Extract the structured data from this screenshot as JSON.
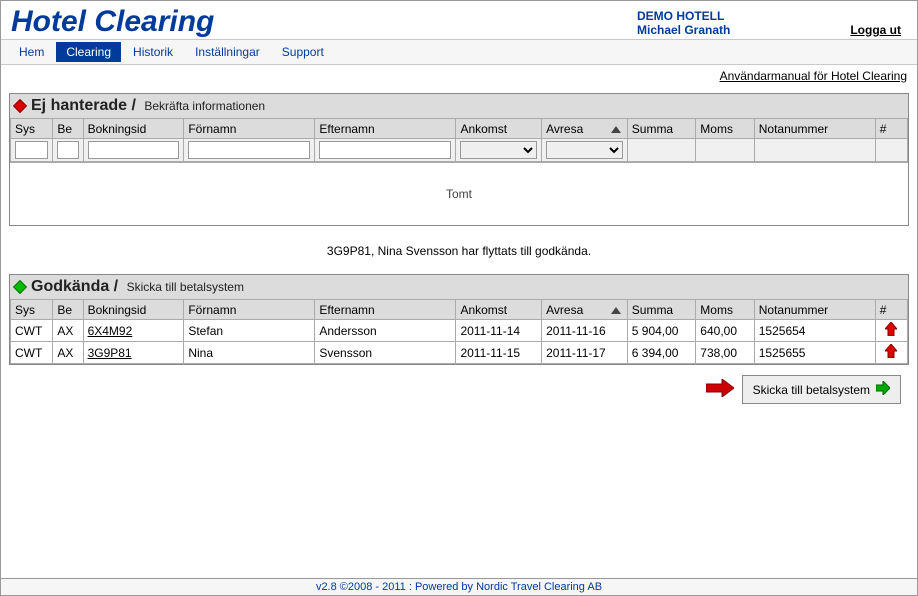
{
  "header": {
    "app_title": "Hotel Clearing",
    "hotel_name": "DEMO HOTELL",
    "user_name": "Michael Granath",
    "logout": "Logga ut"
  },
  "nav": {
    "items": [
      "Hem",
      "Clearing",
      "Historik",
      "Inställningar",
      "Support"
    ],
    "active_index": 1
  },
  "manual_link": "Användarmanual för Hotel Clearing",
  "section1": {
    "title": "Ej hanterade",
    "subtitle": "Bekräfta informationen",
    "cols": [
      "Sys",
      "Be",
      "Bokningsid",
      "Förnamn",
      "Efternamn",
      "Ankomst",
      "Avresa",
      "Summa",
      "Moms",
      "Notanummer",
      "#"
    ],
    "empty": "Tomt"
  },
  "status_message": "3G9P81, Nina Svensson har flyttats till godkända.",
  "section2": {
    "title": "Godkända",
    "subtitle": "Skicka till betalsystem",
    "cols": [
      "Sys",
      "Be",
      "Bokningsid",
      "Förnamn",
      "Efternamn",
      "Ankomst",
      "Avresa",
      "Summa",
      "Moms",
      "Notanummer",
      "#"
    ],
    "rows": [
      {
        "sys": "CWT",
        "be": "AX",
        "book": "6X4M92",
        "first": "Stefan",
        "last": "Andersson",
        "ank": "2011-11-14",
        "avr": "2011-11-16",
        "sum": "5 904,00",
        "moms": "640,00",
        "nota": "1525654"
      },
      {
        "sys": "CWT",
        "be": "AX",
        "book": "3G9P81",
        "first": "Nina",
        "last": "Svensson",
        "ank": "2011-11-15",
        "avr": "2011-11-17",
        "sum": "6 394,00",
        "moms": "738,00",
        "nota": "1525655"
      }
    ]
  },
  "action_button": "Skicka till betalsystem",
  "footer": "v2.8 ©2008 - 2011 : Powered by Nordic Travel Clearing AB"
}
